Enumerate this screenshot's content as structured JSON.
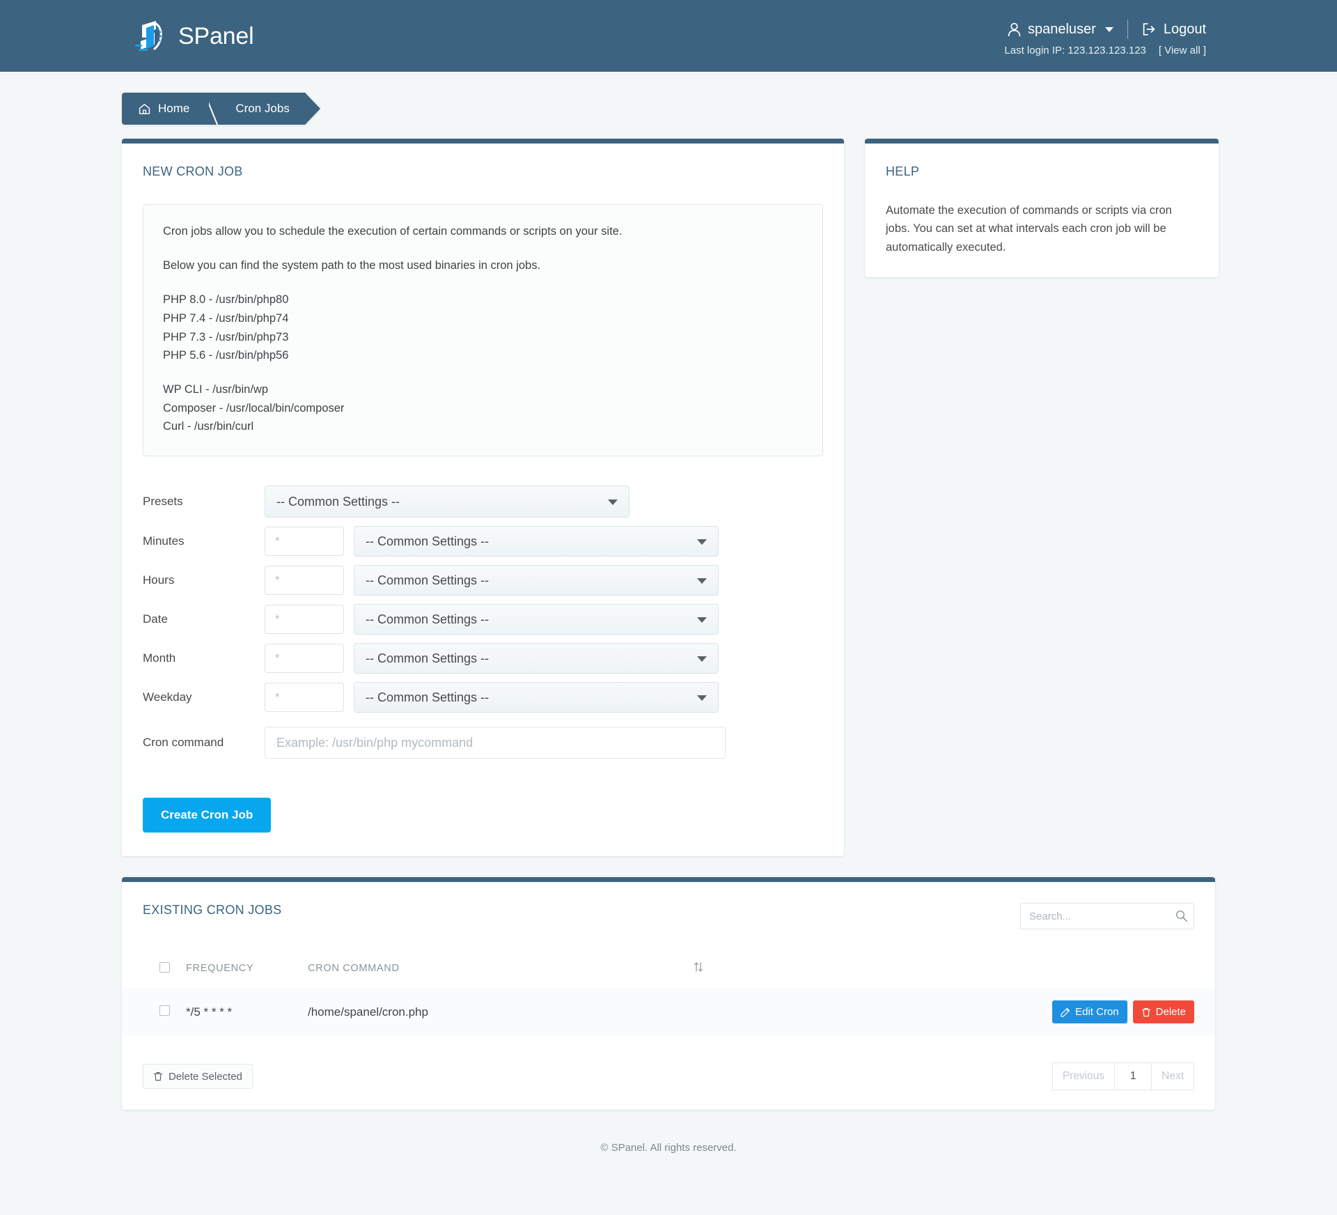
{
  "header": {
    "brand": "SPanel",
    "brand_logo_icon": "spanel-logo-icon",
    "user_icon": "user-icon",
    "username": "spaneluser",
    "logout_icon": "logout-icon",
    "logout_label": "Logout",
    "last_login": "Last login IP: 123.123.123.123",
    "view_all": "[ View all ]"
  },
  "breadcrumb": {
    "home_icon": "home-icon",
    "home": "Home",
    "current": "Cron Jobs"
  },
  "new_cron": {
    "title": "NEW CRON JOB",
    "info": {
      "line1": "Cron jobs allow you to schedule the execution of certain commands or scripts on your site.",
      "line2": "Below you can find the system path to the most used binaries in cron jobs.",
      "php_paths": [
        "PHP 8.0 - /usr/bin/php80",
        "PHP 7.4 - /usr/bin/php74",
        "PHP 7.3 - /usr/bin/php73",
        "PHP 5.6 - /usr/bin/php56"
      ],
      "bin_paths": [
        "WP CLI - /usr/bin/wp",
        "Composer - /usr/local/bin/composer",
        "Curl - /usr/bin/curl"
      ]
    },
    "common_settings": "-- Common Settings --",
    "star_placeholder": "*",
    "fields": [
      {
        "label": "Presets",
        "select": "-- Common Settings --",
        "has_input": false
      },
      {
        "label": "Minutes",
        "select": "-- Common Settings --",
        "has_input": true,
        "value": ""
      },
      {
        "label": "Hours",
        "select": "-- Common Settings --",
        "has_input": true,
        "value": ""
      },
      {
        "label": "Date",
        "select": "-- Common Settings --",
        "has_input": true,
        "value": ""
      },
      {
        "label": "Month",
        "select": "-- Common Settings --",
        "has_input": true,
        "value": ""
      },
      {
        "label": "Weekday",
        "select": "-- Common Settings --",
        "has_input": true,
        "value": ""
      }
    ],
    "command_label": "Cron command",
    "command_placeholder": "Example: /usr/bin/php mycommand",
    "command_value": "",
    "submit_label": "Create Cron Job"
  },
  "help": {
    "title": "HELP",
    "body": "Automate the execution of commands or scripts via cron jobs. You can set at what intervals each cron job will be automatically executed."
  },
  "existing": {
    "title": "EXISTING CRON JOBS",
    "search_placeholder": "Search...",
    "search_value": "",
    "search_icon": "search-icon",
    "columns": {
      "frequency": "FREQUENCY",
      "command": "CRON COMMAND",
      "sort_icon": "sort-updown-icon"
    },
    "rows": [
      {
        "frequency": "*/5 * * * *",
        "command": "/home/spanel/cron.php",
        "edit_label": "Edit Cron",
        "edit_icon": "edit-pencil-icon",
        "delete_label": "Delete",
        "delete_icon": "trash-icon"
      }
    ],
    "delete_selected_label": "Delete Selected",
    "delete_selected_icon": "trash-icon",
    "pagination": {
      "previous": "Previous",
      "page": "1",
      "next": "Next"
    }
  },
  "footer": {
    "text": "© SPanel. All rights reserved."
  },
  "colors": {
    "header_bg": "#3c6480",
    "page_bg": "#f4f7f8",
    "accent_blue": "#06a7ee",
    "edit_blue": "#1f8fe0",
    "delete_red": "#f24a3a",
    "title_blue": "#3c6480"
  }
}
